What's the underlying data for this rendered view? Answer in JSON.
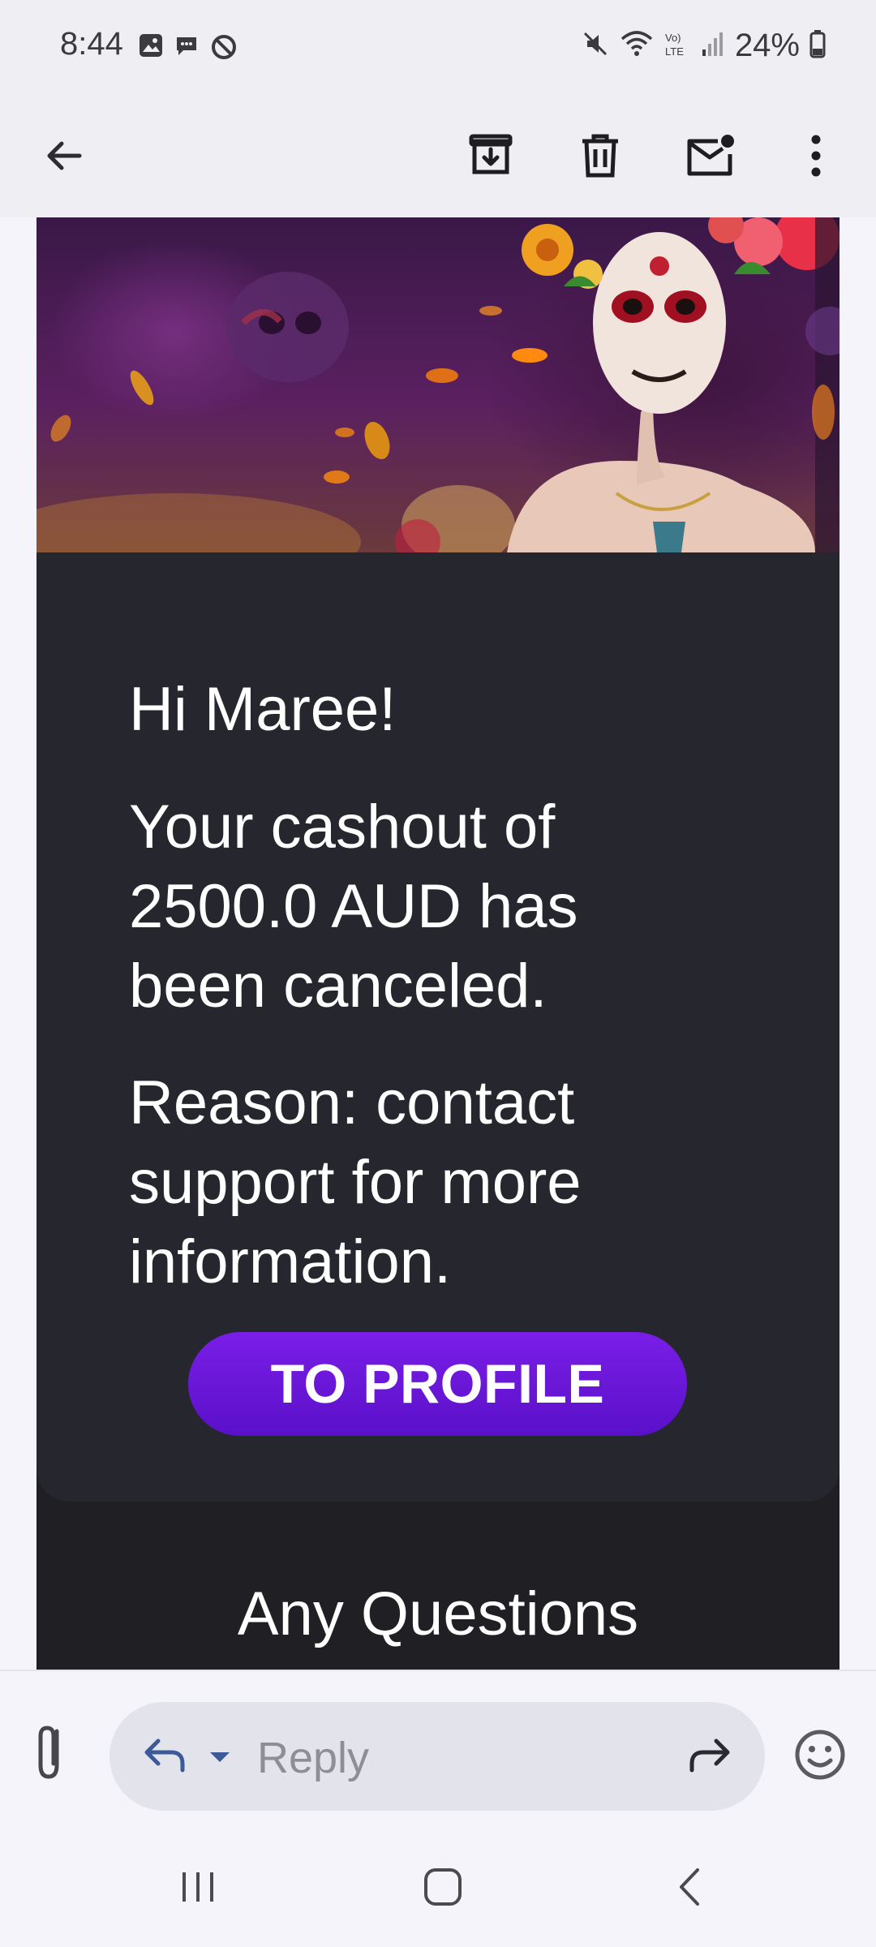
{
  "status_bar": {
    "time": "8:44",
    "battery": "24%",
    "left_icons": [
      "gallery-icon",
      "chat-bubble-icon",
      "sync-icon"
    ],
    "right_icons": [
      "mute-icon",
      "wifi-icon",
      "volte-icon",
      "signal-icon",
      "battery-icon"
    ]
  },
  "app_bar": {
    "back_icon": "arrow-back-icon",
    "actions": [
      "archive-icon",
      "delete-icon",
      "mark-unread-icon",
      "more-vert-icon"
    ]
  },
  "email": {
    "greeting": "Hi Maree!",
    "message": "Your cashout of 2500.0 AUD has been canceled.",
    "reason": "Reason: contact support for more information.",
    "cta_label": "TO PROFILE",
    "questions_heading": "Any Questions"
  },
  "reply_bar": {
    "placeholder": "Reply",
    "icons": [
      "attach-icon",
      "reply-icon",
      "caret-down-icon",
      "forward-icon",
      "emoji-icon"
    ]
  },
  "nav_bar": {
    "buttons": [
      "recents-icon",
      "home-icon",
      "back-icon"
    ]
  },
  "colors": {
    "card_bg": "#26272e",
    "email_bg": "#1f1f24",
    "cta_purple": "#6a14d8",
    "chrome_bg": "#efeef3"
  }
}
